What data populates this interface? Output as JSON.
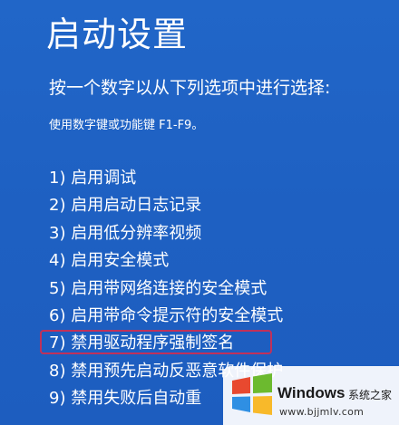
{
  "screen": {
    "title": "启动设置",
    "subtitle": "按一个数字以从下列选项中进行选择:",
    "hint": "使用数字键或功能键 F1-F9。"
  },
  "options": [
    {
      "label": "1) 启用调试"
    },
    {
      "label": "2) 启用启动日志记录"
    },
    {
      "label": "3) 启用低分辨率视频"
    },
    {
      "label": "4) 启用安全模式"
    },
    {
      "label": "5) 启用带网络连接的安全模式"
    },
    {
      "label": "6) 启用带命令提示符的安全模式"
    },
    {
      "label": "7) 禁用驱动程序强制签名",
      "highlighted": true
    },
    {
      "label": "8) 禁用预先启动反恶意软件保护"
    },
    {
      "label": "9) 禁用失败后自动重"
    }
  ],
  "watermark": {
    "brand": "Windows",
    "cn_text": "系统之家",
    "url": "www.bjjmlv.com",
    "icon": "windows-logo-icon"
  },
  "colors": {
    "background": "#1f63c4",
    "text": "#ffffff",
    "highlight_border": "#c0315a"
  }
}
